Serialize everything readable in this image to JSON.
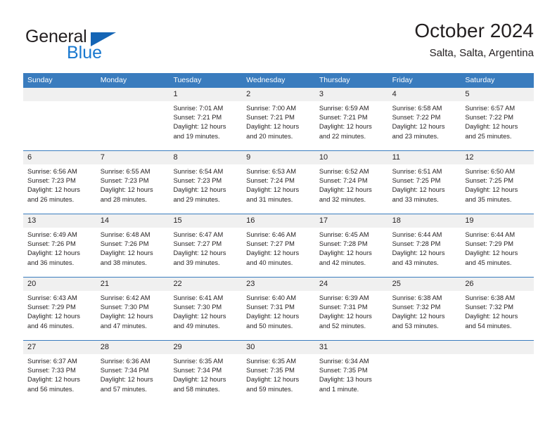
{
  "brand": {
    "name_part1": "General",
    "name_part2": "Blue",
    "triangle_icon": "triangle-icon",
    "accent_color": "#1878cf",
    "header_color": "#3a7cbe"
  },
  "header": {
    "title": "October 2024",
    "subtitle": "Salta, Salta, Argentina"
  },
  "calendar": {
    "weekdays": [
      "Sunday",
      "Monday",
      "Tuesday",
      "Wednesday",
      "Thursday",
      "Friday",
      "Saturday"
    ],
    "weeks": [
      [
        {
          "day": "",
          "sunrise": "",
          "sunset": "",
          "daylight_line1": "",
          "daylight_line2": "",
          "empty": true
        },
        {
          "day": "",
          "sunrise": "",
          "sunset": "",
          "daylight_line1": "",
          "daylight_line2": "",
          "empty": true
        },
        {
          "day": "1",
          "sunrise": "Sunrise: 7:01 AM",
          "sunset": "Sunset: 7:21 PM",
          "daylight_line1": "Daylight: 12 hours",
          "daylight_line2": "and 19 minutes."
        },
        {
          "day": "2",
          "sunrise": "Sunrise: 7:00 AM",
          "sunset": "Sunset: 7:21 PM",
          "daylight_line1": "Daylight: 12 hours",
          "daylight_line2": "and 20 minutes."
        },
        {
          "day": "3",
          "sunrise": "Sunrise: 6:59 AM",
          "sunset": "Sunset: 7:21 PM",
          "daylight_line1": "Daylight: 12 hours",
          "daylight_line2": "and 22 minutes."
        },
        {
          "day": "4",
          "sunrise": "Sunrise: 6:58 AM",
          "sunset": "Sunset: 7:22 PM",
          "daylight_line1": "Daylight: 12 hours",
          "daylight_line2": "and 23 minutes."
        },
        {
          "day": "5",
          "sunrise": "Sunrise: 6:57 AM",
          "sunset": "Sunset: 7:22 PM",
          "daylight_line1": "Daylight: 12 hours",
          "daylight_line2": "and 25 minutes."
        }
      ],
      [
        {
          "day": "6",
          "sunrise": "Sunrise: 6:56 AM",
          "sunset": "Sunset: 7:23 PM",
          "daylight_line1": "Daylight: 12 hours",
          "daylight_line2": "and 26 minutes."
        },
        {
          "day": "7",
          "sunrise": "Sunrise: 6:55 AM",
          "sunset": "Sunset: 7:23 PM",
          "daylight_line1": "Daylight: 12 hours",
          "daylight_line2": "and 28 minutes."
        },
        {
          "day": "8",
          "sunrise": "Sunrise: 6:54 AM",
          "sunset": "Sunset: 7:23 PM",
          "daylight_line1": "Daylight: 12 hours",
          "daylight_line2": "and 29 minutes."
        },
        {
          "day": "9",
          "sunrise": "Sunrise: 6:53 AM",
          "sunset": "Sunset: 7:24 PM",
          "daylight_line1": "Daylight: 12 hours",
          "daylight_line2": "and 31 minutes."
        },
        {
          "day": "10",
          "sunrise": "Sunrise: 6:52 AM",
          "sunset": "Sunset: 7:24 PM",
          "daylight_line1": "Daylight: 12 hours",
          "daylight_line2": "and 32 minutes."
        },
        {
          "day": "11",
          "sunrise": "Sunrise: 6:51 AM",
          "sunset": "Sunset: 7:25 PM",
          "daylight_line1": "Daylight: 12 hours",
          "daylight_line2": "and 33 minutes."
        },
        {
          "day": "12",
          "sunrise": "Sunrise: 6:50 AM",
          "sunset": "Sunset: 7:25 PM",
          "daylight_line1": "Daylight: 12 hours",
          "daylight_line2": "and 35 minutes."
        }
      ],
      [
        {
          "day": "13",
          "sunrise": "Sunrise: 6:49 AM",
          "sunset": "Sunset: 7:26 PM",
          "daylight_line1": "Daylight: 12 hours",
          "daylight_line2": "and 36 minutes."
        },
        {
          "day": "14",
          "sunrise": "Sunrise: 6:48 AM",
          "sunset": "Sunset: 7:26 PM",
          "daylight_line1": "Daylight: 12 hours",
          "daylight_line2": "and 38 minutes."
        },
        {
          "day": "15",
          "sunrise": "Sunrise: 6:47 AM",
          "sunset": "Sunset: 7:27 PM",
          "daylight_line1": "Daylight: 12 hours",
          "daylight_line2": "and 39 minutes."
        },
        {
          "day": "16",
          "sunrise": "Sunrise: 6:46 AM",
          "sunset": "Sunset: 7:27 PM",
          "daylight_line1": "Daylight: 12 hours",
          "daylight_line2": "and 40 minutes."
        },
        {
          "day": "17",
          "sunrise": "Sunrise: 6:45 AM",
          "sunset": "Sunset: 7:28 PM",
          "daylight_line1": "Daylight: 12 hours",
          "daylight_line2": "and 42 minutes."
        },
        {
          "day": "18",
          "sunrise": "Sunrise: 6:44 AM",
          "sunset": "Sunset: 7:28 PM",
          "daylight_line1": "Daylight: 12 hours",
          "daylight_line2": "and 43 minutes."
        },
        {
          "day": "19",
          "sunrise": "Sunrise: 6:44 AM",
          "sunset": "Sunset: 7:29 PM",
          "daylight_line1": "Daylight: 12 hours",
          "daylight_line2": "and 45 minutes."
        }
      ],
      [
        {
          "day": "20",
          "sunrise": "Sunrise: 6:43 AM",
          "sunset": "Sunset: 7:29 PM",
          "daylight_line1": "Daylight: 12 hours",
          "daylight_line2": "and 46 minutes."
        },
        {
          "day": "21",
          "sunrise": "Sunrise: 6:42 AM",
          "sunset": "Sunset: 7:30 PM",
          "daylight_line1": "Daylight: 12 hours",
          "daylight_line2": "and 47 minutes."
        },
        {
          "day": "22",
          "sunrise": "Sunrise: 6:41 AM",
          "sunset": "Sunset: 7:30 PM",
          "daylight_line1": "Daylight: 12 hours",
          "daylight_line2": "and 49 minutes."
        },
        {
          "day": "23",
          "sunrise": "Sunrise: 6:40 AM",
          "sunset": "Sunset: 7:31 PM",
          "daylight_line1": "Daylight: 12 hours",
          "daylight_line2": "and 50 minutes."
        },
        {
          "day": "24",
          "sunrise": "Sunrise: 6:39 AM",
          "sunset": "Sunset: 7:31 PM",
          "daylight_line1": "Daylight: 12 hours",
          "daylight_line2": "and 52 minutes."
        },
        {
          "day": "25",
          "sunrise": "Sunrise: 6:38 AM",
          "sunset": "Sunset: 7:32 PM",
          "daylight_line1": "Daylight: 12 hours",
          "daylight_line2": "and 53 minutes."
        },
        {
          "day": "26",
          "sunrise": "Sunrise: 6:38 AM",
          "sunset": "Sunset: 7:32 PM",
          "daylight_line1": "Daylight: 12 hours",
          "daylight_line2": "and 54 minutes."
        }
      ],
      [
        {
          "day": "27",
          "sunrise": "Sunrise: 6:37 AM",
          "sunset": "Sunset: 7:33 PM",
          "daylight_line1": "Daylight: 12 hours",
          "daylight_line2": "and 56 minutes."
        },
        {
          "day": "28",
          "sunrise": "Sunrise: 6:36 AM",
          "sunset": "Sunset: 7:34 PM",
          "daylight_line1": "Daylight: 12 hours",
          "daylight_line2": "and 57 minutes."
        },
        {
          "day": "29",
          "sunrise": "Sunrise: 6:35 AM",
          "sunset": "Sunset: 7:34 PM",
          "daylight_line1": "Daylight: 12 hours",
          "daylight_line2": "and 58 minutes."
        },
        {
          "day": "30",
          "sunrise": "Sunrise: 6:35 AM",
          "sunset": "Sunset: 7:35 PM",
          "daylight_line1": "Daylight: 12 hours",
          "daylight_line2": "and 59 minutes."
        },
        {
          "day": "31",
          "sunrise": "Sunrise: 6:34 AM",
          "sunset": "Sunset: 7:35 PM",
          "daylight_line1": "Daylight: 13 hours",
          "daylight_line2": "and 1 minute."
        },
        {
          "day": "",
          "sunrise": "",
          "sunset": "",
          "daylight_line1": "",
          "daylight_line2": "",
          "empty": true
        },
        {
          "day": "",
          "sunrise": "",
          "sunset": "",
          "daylight_line1": "",
          "daylight_line2": "",
          "empty": true
        }
      ]
    ]
  }
}
